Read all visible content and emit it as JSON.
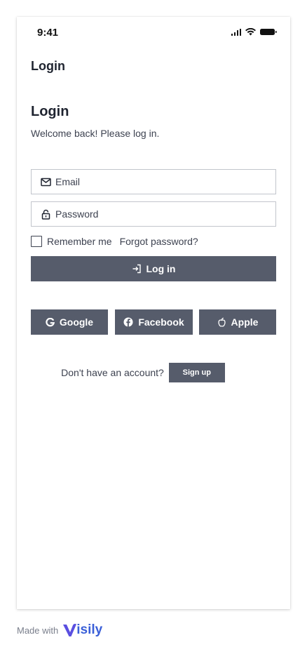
{
  "status_bar": {
    "time": "9:41"
  },
  "nav": {
    "title": "Login"
  },
  "header": {
    "title": "Login",
    "subtitle": "Welcome back! Please log in."
  },
  "form": {
    "email_placeholder": "Email",
    "password_placeholder": "Password",
    "remember_label": "Remember me",
    "remember_checked": false,
    "forgot_label": "Forgot password?",
    "login_label": "Log in"
  },
  "social": {
    "google": "Google",
    "facebook": "Facebook",
    "apple": "Apple"
  },
  "signup": {
    "prompt": "Don't have an account?",
    "button": "Sign up"
  },
  "footer": {
    "made_with": "Made with",
    "brand": "isily"
  },
  "colors": {
    "button_bg": "#565c6b",
    "brand": "#3a5fd8",
    "text": "#1f2430"
  }
}
